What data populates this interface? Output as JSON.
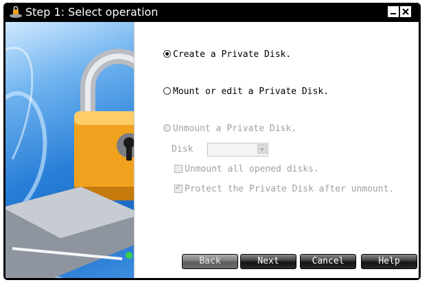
{
  "window": {
    "title": "Step 1: Select operation",
    "title_icon": "private-disk-app-icon",
    "minimize_icon": "minimize-icon",
    "close_icon": "close-icon"
  },
  "banner": {
    "image": "padlock-on-hard-drive-illustration"
  },
  "options": {
    "create": {
      "label": "Create a Private Disk.",
      "selected": true,
      "enabled": true
    },
    "mount": {
      "label": "Mount or edit a Private Disk.",
      "selected": false,
      "enabled": true
    },
    "unmount": {
      "label": "Unmount a Private Disk.",
      "selected": false,
      "enabled": false
    }
  },
  "disk": {
    "label": "Disk",
    "value": ""
  },
  "checkboxes": {
    "unmount_all": {
      "label": "Unmount all opened disks.",
      "checked": false,
      "enabled": false
    },
    "protect": {
      "label": "Protect the Private Disk after unmount.",
      "checked": true,
      "enabled": false
    }
  },
  "buttons": {
    "back": "Back",
    "next": "Next",
    "cancel": "Cancel",
    "help": "Help"
  },
  "colors": {
    "title_bg": "#000000",
    "banner_blue": "#2a80d8",
    "lock_orange": "#f0a21e",
    "disabled_text": "#a0a0a0"
  }
}
